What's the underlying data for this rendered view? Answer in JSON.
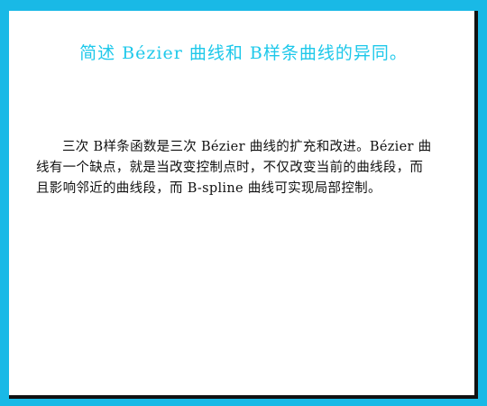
{
  "slide": {
    "title": "简述 Bézier 曲线和 B样条曲线的异同。",
    "paragraph": "三次 B样条函数是三次 Bézier 曲线的扩充和改进。Bézier 曲线有一个缺点，就是当改变控制点时，不仅改变当前的曲线段，而且影响邻近的曲线段，而 B-spline 曲线可实现局部控制。"
  },
  "colors": {
    "frame": "#19b9e6",
    "title": "#1ec8ea",
    "text": "#111111"
  }
}
